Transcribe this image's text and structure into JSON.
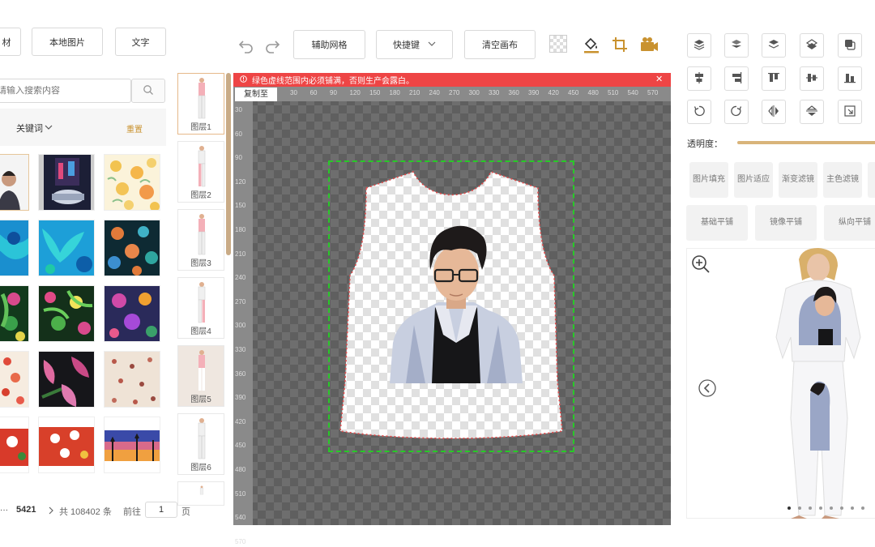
{
  "toolbar": {
    "material_label": "材",
    "local_image_label": "本地图片",
    "text_label": "文字",
    "grid_label": "辅助网格",
    "shortcut_label": "快捷键",
    "clear_label": "清空画布"
  },
  "search": {
    "placeholder": "请输入搜索内容"
  },
  "filter": {
    "keyword_label": "关键词",
    "reset_label": "重置"
  },
  "pagination": {
    "current": "5421",
    "total_text": "共 108402 条",
    "goto_label": "前往",
    "goto_value": "1",
    "page_unit": "页"
  },
  "layers": [
    {
      "label": "图层1"
    },
    {
      "label": "图层2"
    },
    {
      "label": "图层3"
    },
    {
      "label": "图层4"
    },
    {
      "label": "图层5"
    },
    {
      "label": "图层6"
    }
  ],
  "canvas": {
    "warning": "绿色虚线范围内必须铺满，否则生产会露白。",
    "copy_label": "复制至",
    "ruler_top": [
      "30",
      "60",
      "90",
      "120",
      "150",
      "180",
      "210",
      "240",
      "270",
      "300",
      "330",
      "360",
      "390",
      "420",
      "450",
      "480",
      "510",
      "540",
      "570"
    ],
    "ruler_left": [
      "30",
      "60",
      "90",
      "120",
      "150",
      "180",
      "210",
      "240",
      "270",
      "300",
      "330",
      "360",
      "390",
      "420",
      "450",
      "480",
      "510",
      "540",
      "570",
      "600"
    ]
  },
  "right": {
    "opacity_label": "透明度：",
    "fill_buttons": [
      "图片填充",
      "图片适应",
      "渐变滤镜",
      "主色滤镜"
    ],
    "tile_buttons": [
      "基础平铺",
      "镜像平铺",
      "纵向平铺"
    ]
  },
  "colors": {
    "accent": "#ee4545",
    "slider": "#d9b47a",
    "selected_border": "#e6c69a"
  }
}
